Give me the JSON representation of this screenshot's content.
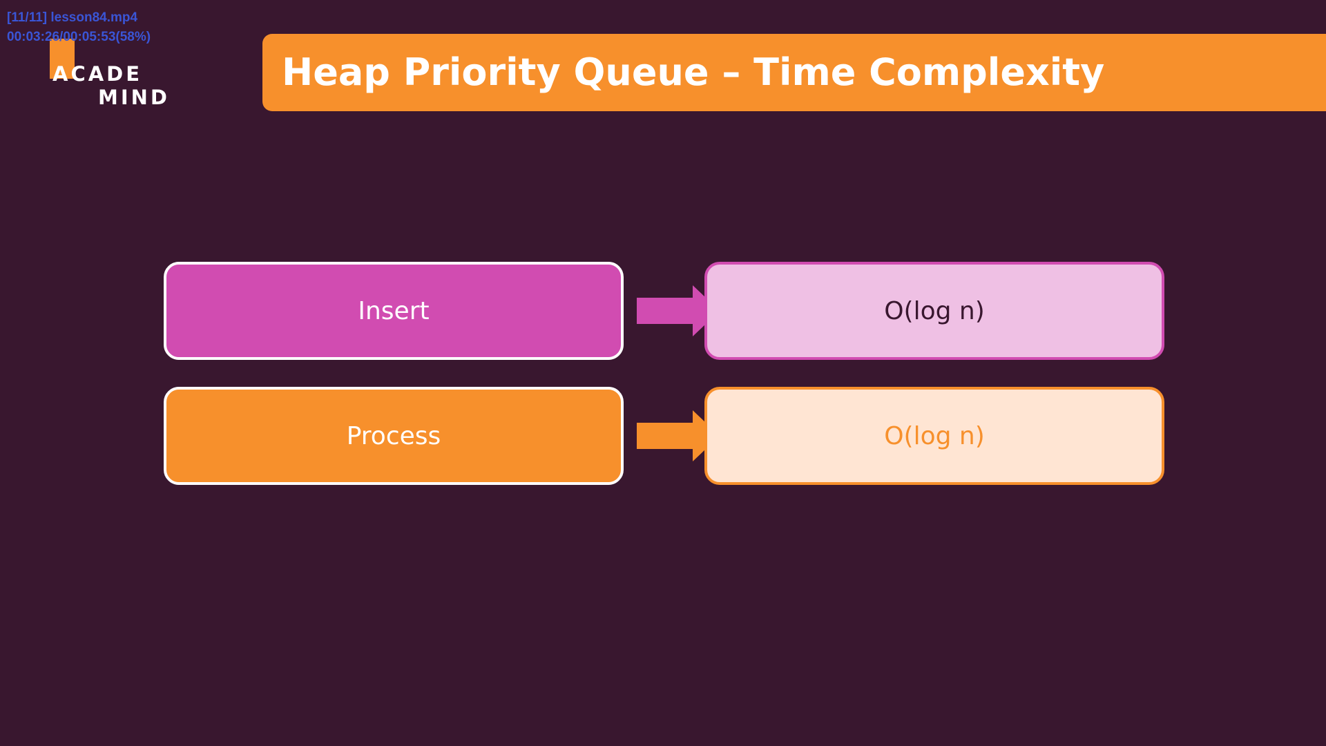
{
  "player_overlay": {
    "file_line": "[11/11] lesson84.mp4",
    "time_line": "00:03:26/00:05:53(58%)"
  },
  "logo": {
    "line1": "ACADE",
    "line2": "MIND"
  },
  "slide": {
    "title": "Heap Priority Queue – Time Complexity",
    "rows": [
      {
        "operation": "Insert",
        "complexity": "O(log n)"
      },
      {
        "operation": "Process",
        "complexity": "O(log n)"
      }
    ]
  },
  "colors": {
    "background": "#39172f",
    "accent_orange": "#f7902c",
    "accent_magenta": "#d14cb1",
    "light_magenta": "#efc0e4",
    "light_orange": "#ffe5d3",
    "overlay_text": "#3a55d6"
  }
}
